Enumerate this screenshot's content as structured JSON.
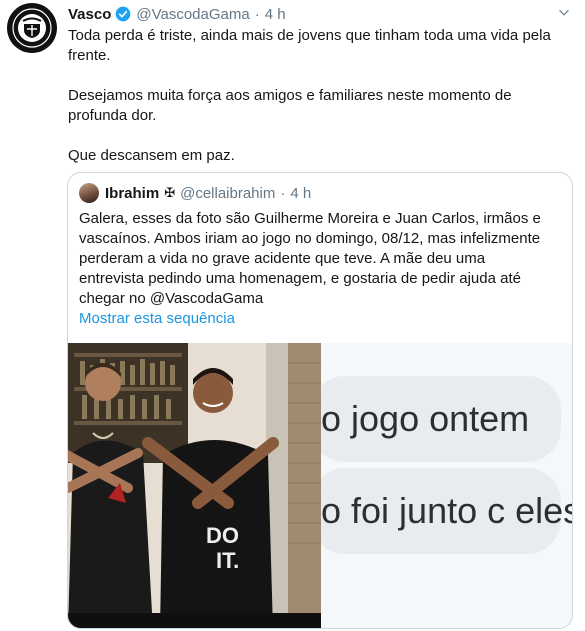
{
  "author": {
    "name": "Vasco",
    "handle": "@VascodaGama",
    "separator": "·",
    "time": "4 h",
    "avatar_icon": "vasco-crest-icon",
    "verified_icon": "verified-badge-icon"
  },
  "tweet": {
    "paragraphs": [
      "Toda perda é triste, ainda mais de jovens que tinham toda uma vida pela frente.",
      "Desejamos muita força aos amigos e familiares neste momento de profunda dor.",
      "Que descansem em paz."
    ]
  },
  "quoted": {
    "name": "Ibrahim",
    "cross": "✠",
    "handle": "@cellaibrahim",
    "separator": "·",
    "time": "4 h",
    "text": "Galera, esses da foto são Guilherme Moreira e Juan Carlos, irmãos e vascaínos. Ambos iriam ao jogo no domingo, 08/12, mas infelizmente perderam a vida no grave acidente que teve. A mãe deu uma entrevista pedindo uma homenagem, e gostaria de pedir ajuda até chegar no @VascodaGama",
    "show_thread": "Mostrar esta sequência",
    "chat_lines": [
      "o jogo ontem",
      "o foi junto c eles"
    ]
  },
  "colors": {
    "link": "#1b95e0",
    "muted": "#657786",
    "verified": "#1da1f2",
    "border": "#ccd6dd"
  }
}
